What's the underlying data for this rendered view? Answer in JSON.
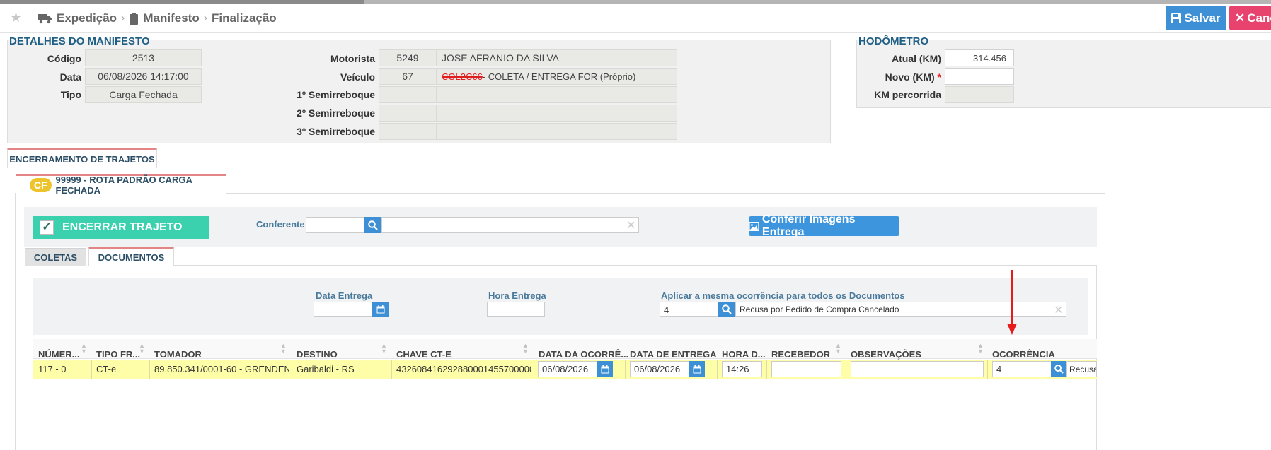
{
  "colors": {
    "accent": "#3d8fd6",
    "danger": "#e8436f",
    "success": "#3cd1ae",
    "badge": "#eec42c",
    "row_highlight": "#fffea8",
    "title": "#1f5f86"
  },
  "breadcrumb": [
    {
      "label": "Expedição",
      "icon": "truck-icon"
    },
    {
      "label": "Manifesto",
      "icon": "clipboard-icon"
    },
    {
      "label": "Finalização"
    }
  ],
  "header": {
    "save_label": "Salvar",
    "cancel_label": "Canc"
  },
  "manifest": {
    "title": "DETALHES DO MANIFESTO",
    "codigo_label": "Código",
    "codigo": "2513",
    "data_label": "Data",
    "data": "06/08/2026 14:17:00",
    "tipo_label": "Tipo",
    "tipo": "Carga Fechada",
    "motorista_label": "Motorista",
    "motorista_code": "5249",
    "motorista_name": "JOSE AFRANIO DA SILVA",
    "veiculo_label": "Veículo",
    "veiculo_code": "67",
    "veiculo_plate": "COL2C66",
    "veiculo_name": "- COLETA / ENTREGA FOR (Próprio)",
    "semi1_label": "1º Semirreboque",
    "semi2_label": "2º Semirreboque",
    "semi3_label": "3º Semirreboque"
  },
  "hodometro": {
    "title": "HODÔMETRO",
    "atual_label": "Atual (KM)",
    "atual": "314.456",
    "novo_label": "Novo (KM)",
    "novo_required": "*",
    "percorrida_label": "KM percorrida"
  },
  "tabs": {
    "encerramento": "ENCERRAMENTO DE TRAJETOS"
  },
  "route": {
    "badge": "CF",
    "label": "99999 - ROTA PADRÃO CARGA FECHADA"
  },
  "actions": {
    "encerrar_label": "ENCERRAR TRAJETO",
    "conferente_label": "Conferente",
    "conferir_label": "Conferir Imagens Entrega"
  },
  "subtabs": {
    "coletas": "COLETAS",
    "documentos": "DOCUMENTOS"
  },
  "filters": {
    "data_entrega_label": "Data Entrega",
    "hora_entrega_label": "Hora Entrega",
    "aplicar_label": "Aplicar a mesma ocorrência para todos os Documentos",
    "ocorrencia_code": "4",
    "ocorrencia_desc": "Recusa por Pedido de Compra Cancelado"
  },
  "table": {
    "columns": [
      "NÚMER...",
      "TIPO FR...",
      "TOMADOR",
      "DESTINO",
      "CHAVE CT-E",
      "DATA DA OCORRÊ...",
      "DATA DE ENTREGA",
      "HORA D...",
      "RECEBEDOR",
      "OBSERVAÇÕES",
      "OCORRÊNCIA"
    ],
    "row": {
      "numero": "117 - 0",
      "tipo": "CT-e",
      "tomador": "89.850.341/0001-60 - GRENDEN...",
      "destino": "Garibaldi - RS",
      "chave": "432608416292880001455700000...",
      "data_ocorrencia": "06/08/2026",
      "data_entrega": "06/08/2026",
      "hora": "14:26",
      "recebedor": "",
      "observacoes": "",
      "ocorrencia_code": "4",
      "ocorrencia_desc": "Recusa"
    }
  }
}
